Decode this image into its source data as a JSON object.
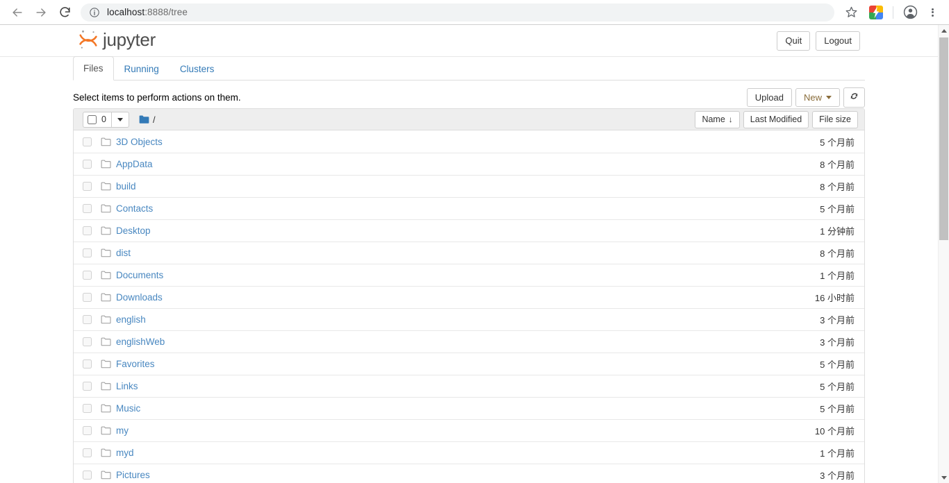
{
  "browser": {
    "back_icon": "back-arrow-icon",
    "forward_icon": "forward-arrow-icon",
    "reload_icon": "reload-icon",
    "info_icon": "info-circle-icon",
    "url_host": "localhost",
    "url_path": ":8888/tree",
    "star_icon": "star-icon",
    "extension_icon": "extension-icon",
    "profile_icon": "profile-avatar-icon",
    "menu_icon": "three-dot-menu-icon"
  },
  "header": {
    "logo_text": "jupyter",
    "quit_label": "Quit",
    "logout_label": "Logout"
  },
  "tabs": [
    {
      "label": "Files",
      "active": true
    },
    {
      "label": "Running",
      "active": false
    },
    {
      "label": "Clusters",
      "active": false
    }
  ],
  "actions": {
    "hint": "Select items to perform actions on them.",
    "upload_label": "Upload",
    "new_label": "New",
    "refresh_icon": "refresh-icon"
  },
  "list_toolbar": {
    "select_count": "0",
    "breadcrumb_root": "/",
    "folder_icon": "folder-filled-icon",
    "sort_name": "Name",
    "sort_name_arrow": "↓",
    "sort_modified": "Last Modified",
    "sort_filesize": "File size"
  },
  "files": [
    {
      "name": "3D Objects",
      "modified": "5 个月前",
      "size": "",
      "icon": "folder-icon"
    },
    {
      "name": "AppData",
      "modified": "8 个月前",
      "size": "",
      "icon": "folder-icon"
    },
    {
      "name": "build",
      "modified": "8 个月前",
      "size": "",
      "icon": "folder-icon"
    },
    {
      "name": "Contacts",
      "modified": "5 个月前",
      "size": "",
      "icon": "folder-icon"
    },
    {
      "name": "Desktop",
      "modified": "1 分钟前",
      "size": "",
      "icon": "folder-icon"
    },
    {
      "name": "dist",
      "modified": "8 个月前",
      "size": "",
      "icon": "folder-icon"
    },
    {
      "name": "Documents",
      "modified": "1 个月前",
      "size": "",
      "icon": "folder-icon"
    },
    {
      "name": "Downloads",
      "modified": "16 小时前",
      "size": "",
      "icon": "folder-icon"
    },
    {
      "name": "english",
      "modified": "3 个月前",
      "size": "",
      "icon": "folder-icon"
    },
    {
      "name": "englishWeb",
      "modified": "3 个月前",
      "size": "",
      "icon": "folder-icon"
    },
    {
      "name": "Favorites",
      "modified": "5 个月前",
      "size": "",
      "icon": "folder-icon"
    },
    {
      "name": "Links",
      "modified": "5 个月前",
      "size": "",
      "icon": "folder-icon"
    },
    {
      "name": "Music",
      "modified": "5 个月前",
      "size": "",
      "icon": "folder-icon"
    },
    {
      "name": "my",
      "modified": "10 个月前",
      "size": "",
      "icon": "folder-icon"
    },
    {
      "name": "myd",
      "modified": "1 个月前",
      "size": "",
      "icon": "folder-icon"
    },
    {
      "name": "Pictures",
      "modified": "3 个月前",
      "size": "",
      "icon": "folder-icon"
    }
  ],
  "colors": {
    "link": "#4887c0",
    "tab_link": "#337ab7",
    "logo_orange": "#f37726",
    "toolbar_bg": "#eeeeee",
    "border": "#dddddd"
  }
}
